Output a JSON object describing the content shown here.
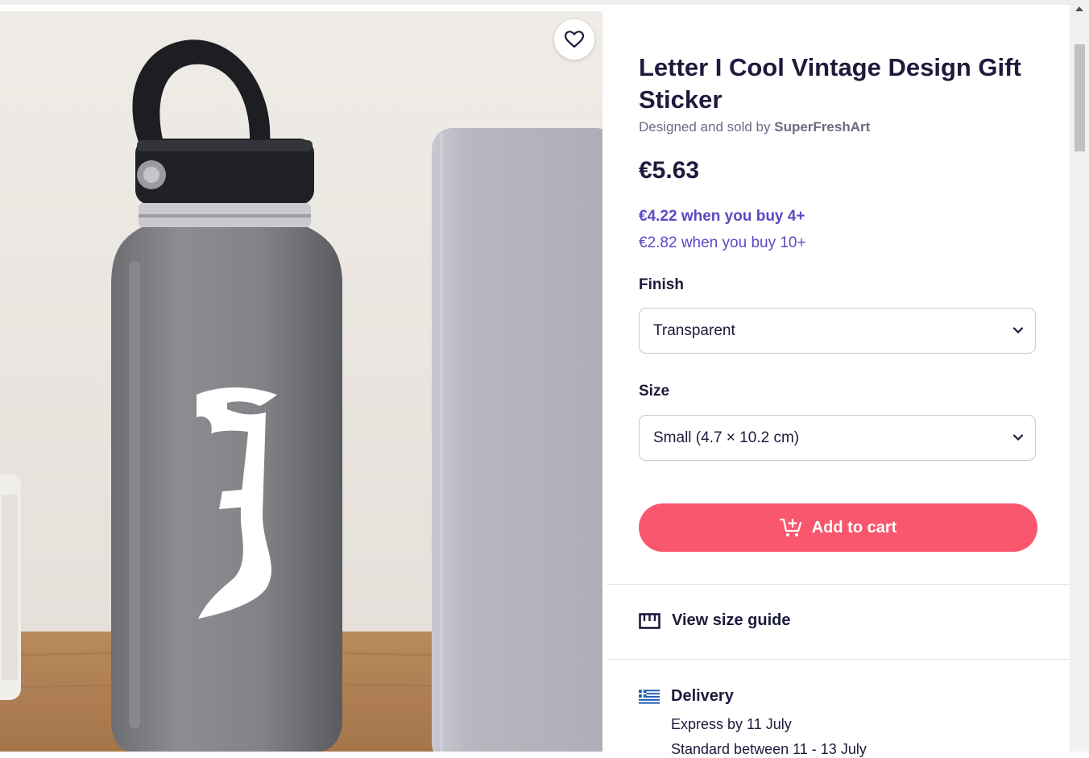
{
  "product": {
    "title": "Letter I Cool Vintage Design Gift Sticker",
    "designed_by_prefix": "Designed and sold by",
    "artist": "SuperFreshArt",
    "price": "€5.63",
    "bulk_tiers": [
      "€4.22 when you buy 4+",
      "€2.82 when you buy 10+"
    ],
    "sticker_letter": "J"
  },
  "options": {
    "finish_label": "Finish",
    "finish_value": "Transparent",
    "size_label": "Size",
    "size_value": "Small (4.7 × 10.2 cm)"
  },
  "actions": {
    "add_to_cart": "Add to cart",
    "size_guide": "View size guide",
    "favorite_icon": "heart-icon",
    "cart_icon": "cart-plus-icon",
    "ruler_icon": "ruler-icon"
  },
  "delivery": {
    "title": "Delivery",
    "flag_icon": "greek-flag-icon",
    "lines": [
      "Express by 11 July",
      "Standard between 11 - 13 July"
    ]
  },
  "colors": {
    "accent_button": "#f9576e",
    "tier_text": "#5b49c4",
    "heading_text": "#1c1b3c"
  }
}
